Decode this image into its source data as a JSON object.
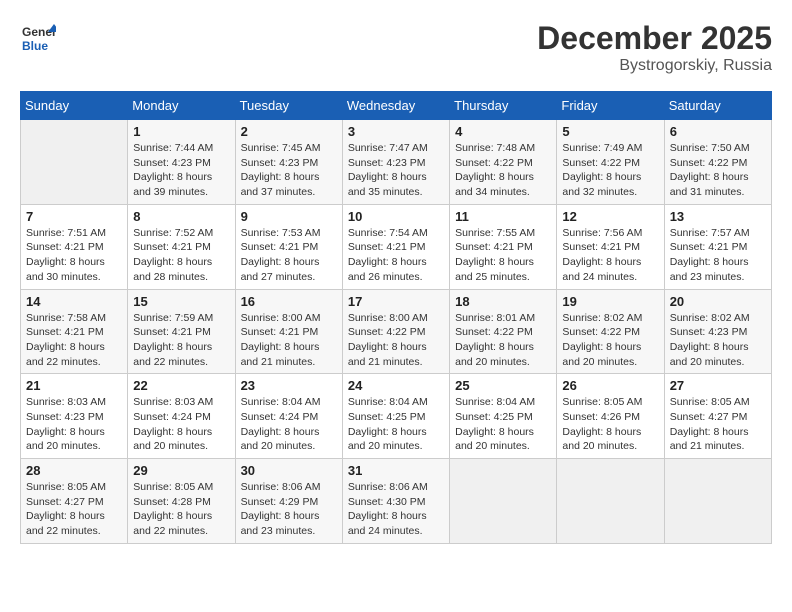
{
  "header": {
    "logo_line1": "General",
    "logo_line2": "Blue",
    "month": "December 2025",
    "location": "Bystrogorskiy, Russia"
  },
  "weekdays": [
    "Sunday",
    "Monday",
    "Tuesday",
    "Wednesday",
    "Thursday",
    "Friday",
    "Saturday"
  ],
  "weeks": [
    [
      {
        "day": "",
        "info": ""
      },
      {
        "day": "1",
        "info": "Sunrise: 7:44 AM\nSunset: 4:23 PM\nDaylight: 8 hours\nand 39 minutes."
      },
      {
        "day": "2",
        "info": "Sunrise: 7:45 AM\nSunset: 4:23 PM\nDaylight: 8 hours\nand 37 minutes."
      },
      {
        "day": "3",
        "info": "Sunrise: 7:47 AM\nSunset: 4:23 PM\nDaylight: 8 hours\nand 35 minutes."
      },
      {
        "day": "4",
        "info": "Sunrise: 7:48 AM\nSunset: 4:22 PM\nDaylight: 8 hours\nand 34 minutes."
      },
      {
        "day": "5",
        "info": "Sunrise: 7:49 AM\nSunset: 4:22 PM\nDaylight: 8 hours\nand 32 minutes."
      },
      {
        "day": "6",
        "info": "Sunrise: 7:50 AM\nSunset: 4:22 PM\nDaylight: 8 hours\nand 31 minutes."
      }
    ],
    [
      {
        "day": "7",
        "info": "Sunrise: 7:51 AM\nSunset: 4:21 PM\nDaylight: 8 hours\nand 30 minutes."
      },
      {
        "day": "8",
        "info": "Sunrise: 7:52 AM\nSunset: 4:21 PM\nDaylight: 8 hours\nand 28 minutes."
      },
      {
        "day": "9",
        "info": "Sunrise: 7:53 AM\nSunset: 4:21 PM\nDaylight: 8 hours\nand 27 minutes."
      },
      {
        "day": "10",
        "info": "Sunrise: 7:54 AM\nSunset: 4:21 PM\nDaylight: 8 hours\nand 26 minutes."
      },
      {
        "day": "11",
        "info": "Sunrise: 7:55 AM\nSunset: 4:21 PM\nDaylight: 8 hours\nand 25 minutes."
      },
      {
        "day": "12",
        "info": "Sunrise: 7:56 AM\nSunset: 4:21 PM\nDaylight: 8 hours\nand 24 minutes."
      },
      {
        "day": "13",
        "info": "Sunrise: 7:57 AM\nSunset: 4:21 PM\nDaylight: 8 hours\nand 23 minutes."
      }
    ],
    [
      {
        "day": "14",
        "info": "Sunrise: 7:58 AM\nSunset: 4:21 PM\nDaylight: 8 hours\nand 22 minutes."
      },
      {
        "day": "15",
        "info": "Sunrise: 7:59 AM\nSunset: 4:21 PM\nDaylight: 8 hours\nand 22 minutes."
      },
      {
        "day": "16",
        "info": "Sunrise: 8:00 AM\nSunset: 4:21 PM\nDaylight: 8 hours\nand 21 minutes."
      },
      {
        "day": "17",
        "info": "Sunrise: 8:00 AM\nSunset: 4:22 PM\nDaylight: 8 hours\nand 21 minutes."
      },
      {
        "day": "18",
        "info": "Sunrise: 8:01 AM\nSunset: 4:22 PM\nDaylight: 8 hours\nand 20 minutes."
      },
      {
        "day": "19",
        "info": "Sunrise: 8:02 AM\nSunset: 4:22 PM\nDaylight: 8 hours\nand 20 minutes."
      },
      {
        "day": "20",
        "info": "Sunrise: 8:02 AM\nSunset: 4:23 PM\nDaylight: 8 hours\nand 20 minutes."
      }
    ],
    [
      {
        "day": "21",
        "info": "Sunrise: 8:03 AM\nSunset: 4:23 PM\nDaylight: 8 hours\nand 20 minutes."
      },
      {
        "day": "22",
        "info": "Sunrise: 8:03 AM\nSunset: 4:24 PM\nDaylight: 8 hours\nand 20 minutes."
      },
      {
        "day": "23",
        "info": "Sunrise: 8:04 AM\nSunset: 4:24 PM\nDaylight: 8 hours\nand 20 minutes."
      },
      {
        "day": "24",
        "info": "Sunrise: 8:04 AM\nSunset: 4:25 PM\nDaylight: 8 hours\nand 20 minutes."
      },
      {
        "day": "25",
        "info": "Sunrise: 8:04 AM\nSunset: 4:25 PM\nDaylight: 8 hours\nand 20 minutes."
      },
      {
        "day": "26",
        "info": "Sunrise: 8:05 AM\nSunset: 4:26 PM\nDaylight: 8 hours\nand 20 minutes."
      },
      {
        "day": "27",
        "info": "Sunrise: 8:05 AM\nSunset: 4:27 PM\nDaylight: 8 hours\nand 21 minutes."
      }
    ],
    [
      {
        "day": "28",
        "info": "Sunrise: 8:05 AM\nSunset: 4:27 PM\nDaylight: 8 hours\nand 22 minutes."
      },
      {
        "day": "29",
        "info": "Sunrise: 8:05 AM\nSunset: 4:28 PM\nDaylight: 8 hours\nand 22 minutes."
      },
      {
        "day": "30",
        "info": "Sunrise: 8:06 AM\nSunset: 4:29 PM\nDaylight: 8 hours\nand 23 minutes."
      },
      {
        "day": "31",
        "info": "Sunrise: 8:06 AM\nSunset: 4:30 PM\nDaylight: 8 hours\nand 24 minutes."
      },
      {
        "day": "",
        "info": ""
      },
      {
        "day": "",
        "info": ""
      },
      {
        "day": "",
        "info": ""
      }
    ]
  ]
}
